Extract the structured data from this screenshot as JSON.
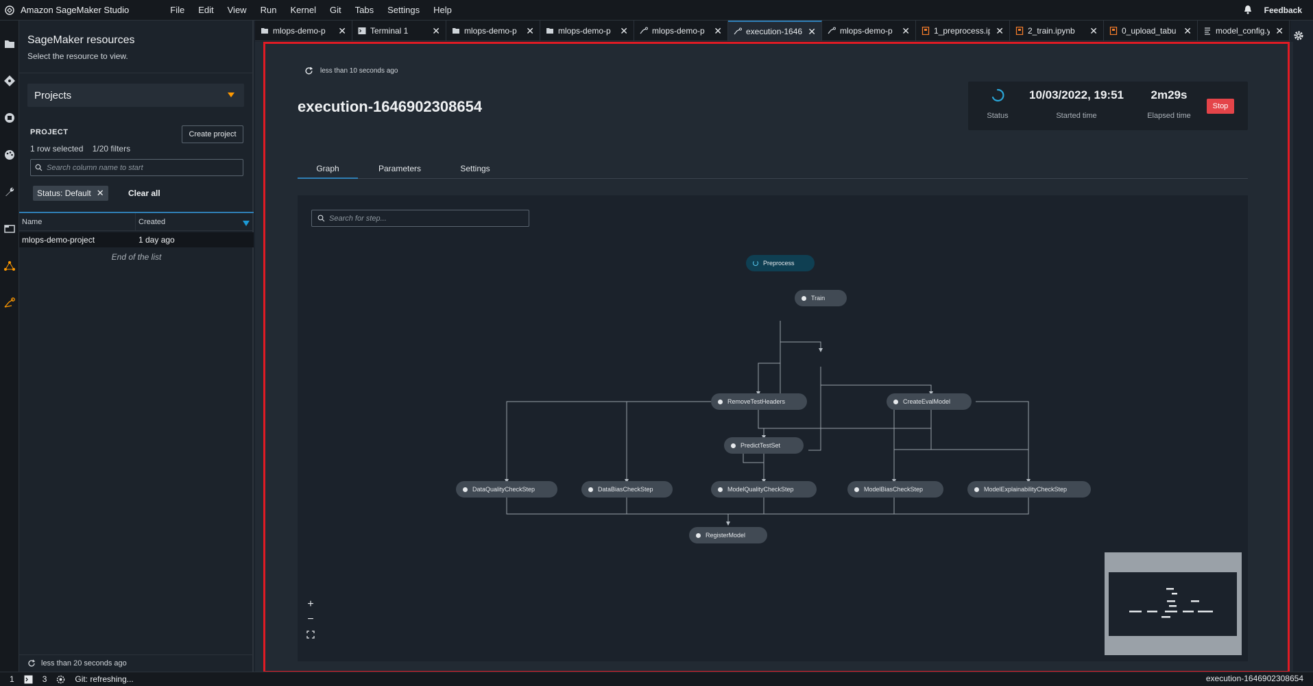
{
  "app": {
    "title": "Amazon SageMaker Studio",
    "menu": [
      "File",
      "Edit",
      "View",
      "Run",
      "Kernel",
      "Git",
      "Tabs",
      "Settings",
      "Help"
    ],
    "feedback": "Feedback"
  },
  "sidebar": {
    "title": "SageMaker resources",
    "subtitle": "Select the resource to view.",
    "select_value": "Projects",
    "project_label": "PROJECT",
    "create_button": "Create project",
    "rows_selected": "1 row selected",
    "filters": "1/20 filters",
    "search_placeholder": "Search column name to start",
    "status_chip": "Status: Default",
    "clear_all": "Clear all",
    "columns": [
      "Name",
      "Created"
    ],
    "rows": [
      {
        "name": "mlops-demo-project",
        "created": "1 day ago"
      }
    ],
    "end_text": "End of the list",
    "footer_refresh": "less than 20 seconds ago"
  },
  "tabs": [
    {
      "label": "mlops-demo-p",
      "icon": "project-icon",
      "active": false
    },
    {
      "label": "Terminal 1",
      "icon": "terminal-icon",
      "active": false
    },
    {
      "label": "mlops-demo-p",
      "icon": "project-icon",
      "active": false
    },
    {
      "label": "mlops-demo-p",
      "icon": "project-icon",
      "active": false
    },
    {
      "label": "mlops-demo-p",
      "icon": "pipeline-icon",
      "active": false
    },
    {
      "label": "execution-1646",
      "icon": "pipeline-icon",
      "active": true
    },
    {
      "label": "mlops-demo-p",
      "icon": "pipeline-icon",
      "active": false
    },
    {
      "label": "1_preprocess.ip",
      "icon": "notebook-icon",
      "active": false
    },
    {
      "label": "2_train.ipynb",
      "icon": "notebook-icon",
      "active": false
    },
    {
      "label": "0_upload_tabu",
      "icon": "notebook-icon",
      "active": false
    },
    {
      "label": "model_config.y",
      "icon": "file-icon",
      "active": false
    }
  ],
  "execution": {
    "refresh_text": "less than 10 seconds ago",
    "title": "execution-1646902308654",
    "status_label": "Status",
    "started_value": "10/03/2022, 19:51",
    "started_label": "Started time",
    "elapsed_value": "2m29s",
    "elapsed_label": "Elapsed time",
    "stop_button": "Stop",
    "tabs": [
      "Graph",
      "Parameters",
      "Settings"
    ],
    "search_placeholder": "Search for step..."
  },
  "graph": {
    "nodes": [
      {
        "id": "Preprocess",
        "state": "running"
      },
      {
        "id": "Train",
        "state": "pending"
      },
      {
        "id": "RemoveTestHeaders",
        "state": "pending"
      },
      {
        "id": "CreateEvalModel",
        "state": "pending"
      },
      {
        "id": "PredictTestSet",
        "state": "pending"
      },
      {
        "id": "DataQualityCheckStep",
        "state": "pending"
      },
      {
        "id": "DataBiasCheckStep",
        "state": "pending"
      },
      {
        "id": "ModelQualityCheckStep",
        "state": "pending"
      },
      {
        "id": "ModelBiasCheckStep",
        "state": "pending"
      },
      {
        "id": "ModelExplainabilityCheckStep",
        "state": "pending"
      },
      {
        "id": "RegisterModel",
        "state": "pending"
      }
    ]
  },
  "statusbar": {
    "item1": "1",
    "item2": "3",
    "git": "Git: refreshing...",
    "right": "execution-1646902308654"
  },
  "colors": {
    "accent": "#2f7fb6",
    "stop": "#e44449",
    "brand": "#ff9900",
    "highlight": "#e01b24"
  }
}
